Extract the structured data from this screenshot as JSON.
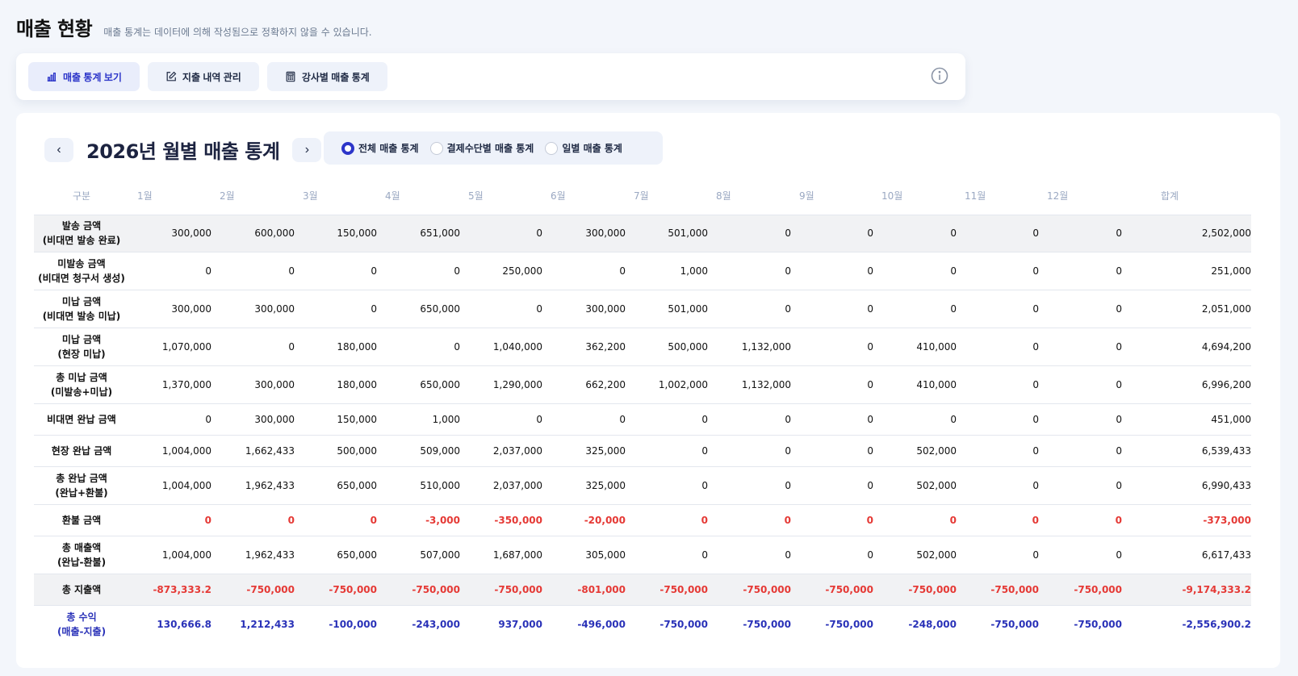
{
  "header": {
    "title": "매출 현황",
    "subtitle": "매출 통계는 데이터에 의해 작성됨으로 정확하지 않을 수 있습니다."
  },
  "tabs": [
    {
      "label": "매출 통계 보기",
      "icon": "bar-chart-icon"
    },
    {
      "label": "지출 내역 관리",
      "icon": "edit-icon"
    },
    {
      "label": "강사별 매출 통계",
      "icon": "calculator-icon"
    }
  ],
  "year_nav": {
    "title": "2026년 월별 매출 통계",
    "prev": "‹",
    "next": "›"
  },
  "view_options": [
    {
      "label": "전체 매출 통계",
      "checked": true
    },
    {
      "label": "결제수단별 매출 통계",
      "checked": false
    },
    {
      "label": "일별 매출 통계",
      "checked": false
    }
  ],
  "table": {
    "headers": [
      "구분",
      "1월",
      "2월",
      "3월",
      "4월",
      "5월",
      "6월",
      "7월",
      "8월",
      "9월",
      "10월",
      "11월",
      "12월",
      "합계"
    ],
    "rows": [
      {
        "label1": "발송 금액",
        "label2": "(비대면 발송 완료)",
        "values": [
          "300,000",
          "600,000",
          "150,000",
          "651,000",
          "0",
          "300,000",
          "501,000",
          "0",
          "0",
          "0",
          "0",
          "0",
          "2,502,000"
        ]
      },
      {
        "label1": "미발송 금액",
        "label2": "(비대면 청구서 생성)",
        "values": [
          "0",
          "0",
          "0",
          "0",
          "250,000",
          "0",
          "1,000",
          "0",
          "0",
          "0",
          "0",
          "0",
          "251,000"
        ]
      },
      {
        "label1": "미납 금액",
        "label2": "(비대면 발송 미납)",
        "values": [
          "300,000",
          "300,000",
          "0",
          "650,000",
          "0",
          "300,000",
          "501,000",
          "0",
          "0",
          "0",
          "0",
          "0",
          "2,051,000"
        ]
      },
      {
        "label1": "미납 금액",
        "label2": "(현장 미납)",
        "values": [
          "1,070,000",
          "0",
          "180,000",
          "0",
          "1,040,000",
          "362,200",
          "500,000",
          "1,132,000",
          "0",
          "410,000",
          "0",
          "0",
          "4,694,200"
        ]
      },
      {
        "label1": "총 미납 금액",
        "label2": "(미발송+미납)",
        "values": [
          "1,370,000",
          "300,000",
          "180,000",
          "650,000",
          "1,290,000",
          "662,200",
          "1,002,000",
          "1,132,000",
          "0",
          "410,000",
          "0",
          "0",
          "6,996,200"
        ]
      },
      {
        "label1": "비대면 완납 금액",
        "label2": "",
        "values": [
          "0",
          "300,000",
          "150,000",
          "1,000",
          "0",
          "0",
          "0",
          "0",
          "0",
          "0",
          "0",
          "0",
          "451,000"
        ]
      },
      {
        "label1": "현장 완납 금액",
        "label2": "",
        "values": [
          "1,004,000",
          "1,662,433",
          "500,000",
          "509,000",
          "2,037,000",
          "325,000",
          "0",
          "0",
          "0",
          "502,000",
          "0",
          "0",
          "6,539,433"
        ]
      },
      {
        "label1": "총 완납 금액",
        "label2": "(완납+환불)",
        "values": [
          "1,004,000",
          "1,962,433",
          "650,000",
          "510,000",
          "2,037,000",
          "325,000",
          "0",
          "0",
          "0",
          "502,000",
          "0",
          "0",
          "6,990,433"
        ]
      },
      {
        "label1": "환불 금액",
        "label2": "",
        "values": [
          "0",
          "0",
          "0",
          "-3,000",
          "-350,000",
          "-20,000",
          "0",
          "0",
          "0",
          "0",
          "0",
          "0",
          "-373,000"
        ]
      },
      {
        "label1": "총 매출액",
        "label2": "(완납-환불)",
        "values": [
          "1,004,000",
          "1,962,433",
          "650,000",
          "507,000",
          "1,687,000",
          "305,000",
          "0",
          "0",
          "0",
          "502,000",
          "0",
          "0",
          "6,617,433"
        ]
      },
      {
        "label1": "총 지출액",
        "label2": "",
        "values": [
          "-873,333.2",
          "-750,000",
          "-750,000",
          "-750,000",
          "-750,000",
          "-801,000",
          "-750,000",
          "-750,000",
          "-750,000",
          "-750,000",
          "-750,000",
          "-750,000",
          "-9,174,333.2"
        ]
      },
      {
        "label1": "총 수익",
        "label2": "(매출-지출)",
        "values": [
          "130,666.8",
          "1,212,433",
          "-100,000",
          "-243,000",
          "937,000",
          "-496,000",
          "-750,000",
          "-750,000",
          "-750,000",
          "-248,000",
          "-750,000",
          "-750,000",
          "-2,556,900.2"
        ]
      }
    ]
  }
}
